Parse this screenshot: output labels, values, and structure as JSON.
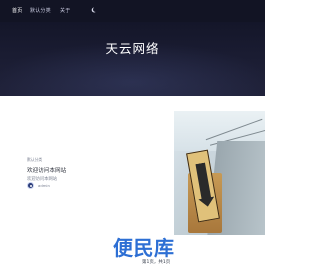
{
  "nav": {
    "items": [
      {
        "label": "首页",
        "active": true
      },
      {
        "label": "默认分类",
        "active": false
      },
      {
        "label": "关于",
        "active": false
      }
    ],
    "theme_toggle_icon": "moon-icon"
  },
  "hero": {
    "title": "天云网络"
  },
  "post": {
    "tag": "默认分类",
    "title": "欢迎访问本网站",
    "subtitle": "欢迎访问本网站",
    "author": "admin"
  },
  "watermark": "便民库",
  "pagination": {
    "text": "第1页，共1页"
  }
}
